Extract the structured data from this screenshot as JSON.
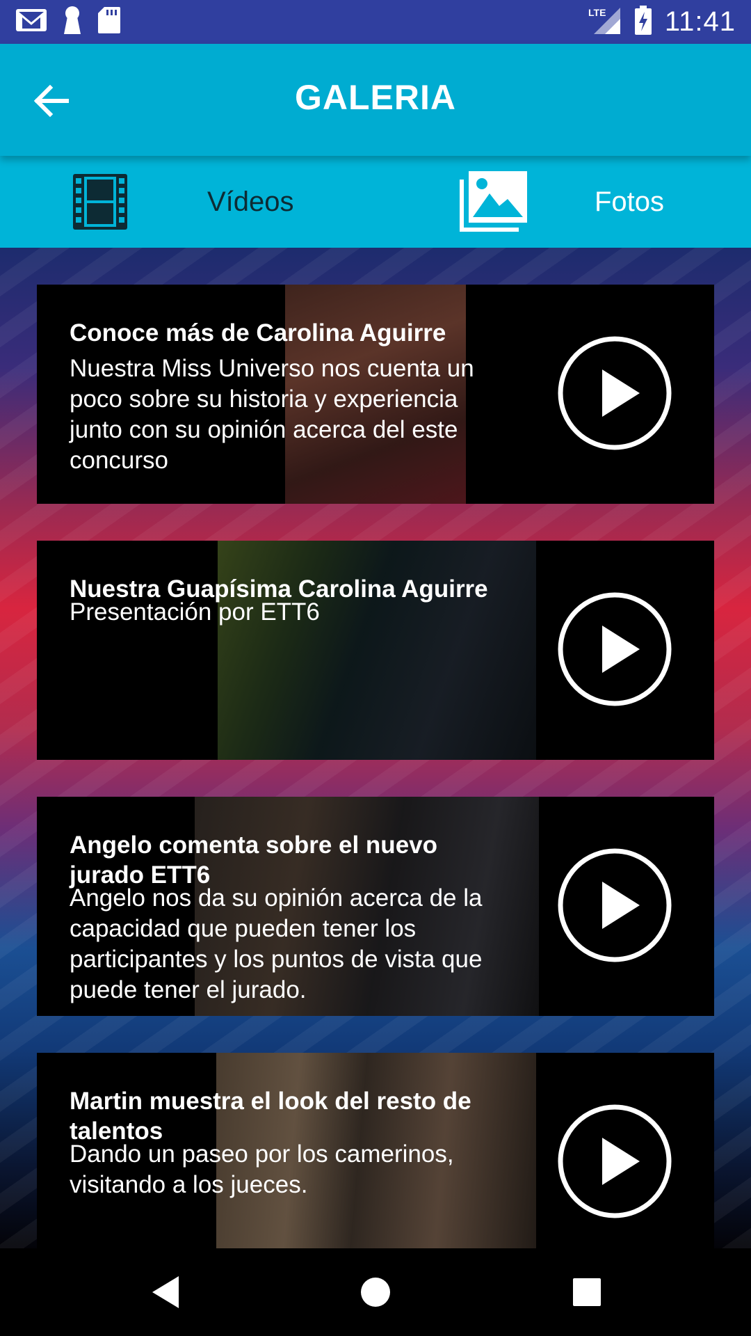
{
  "status_bar": {
    "time": "11:41",
    "network": "LTE",
    "left_icons": [
      "gmail-icon",
      "keyhole-icon",
      "sd-card-icon"
    ],
    "right_icons": [
      "lte-signal-icon",
      "battery-charging-icon"
    ]
  },
  "app_bar": {
    "title": "GALERIA",
    "back_icon": "arrow-left-icon"
  },
  "tabs": [
    {
      "label": "Vídeos",
      "icon": "film-icon",
      "color": "#0d2b34"
    },
    {
      "label": "Fotos",
      "icon": "photo-gallery-icon",
      "color": "#ffffff"
    }
  ],
  "videos": [
    {
      "title": "Conoce más de Carolina Aguirre",
      "description": "Nuestra Miss Universo nos cuenta un poco sobre su historia y experiencia junto con su opinión acerca del este concurso"
    },
    {
      "title": "Nuestra Guapísima Carolina Aguirre",
      "description": "Presentación por ETT6"
    },
    {
      "title": "Angelo comenta sobre el nuevo jurado ETT6",
      "description": "Angelo nos da su opinión acerca de la capacidad que pueden tener los participantes y los puntos de vista que puede tener el jurado."
    },
    {
      "title": "Martin muestra el look del resto de talentos",
      "description": "Dando un paseo por los camerinos, visitando a los jueces."
    }
  ],
  "nav_bar": {
    "buttons": [
      "back-triangle-icon",
      "home-circle-icon",
      "recents-square-icon"
    ]
  },
  "colors": {
    "status_bar": "#303f9f",
    "app_bar": "#00acd1",
    "tabs": "#00b4d8",
    "card": "#000000"
  }
}
